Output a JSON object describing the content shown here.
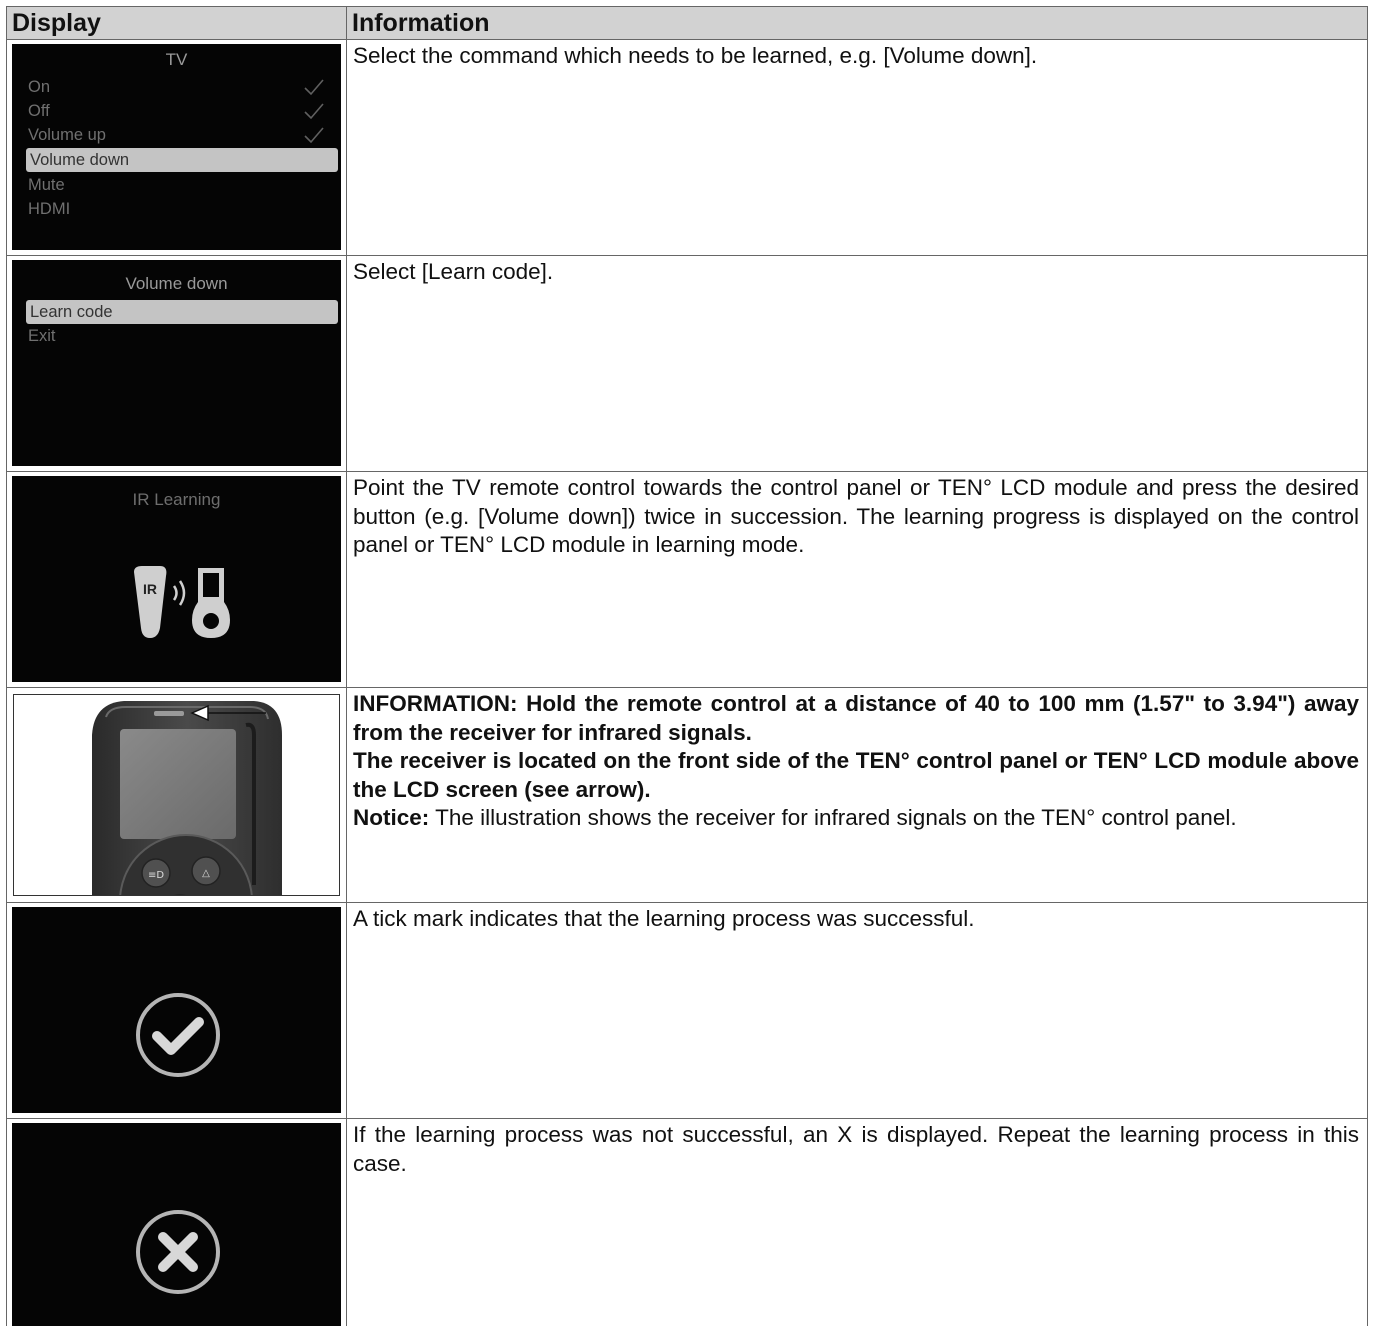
{
  "header": {
    "display": "Display",
    "information": "Information"
  },
  "rows": [
    {
      "screen": {
        "title": "TV",
        "items": [
          {
            "label": "On",
            "checked": true,
            "selected": false
          },
          {
            "label": "Off",
            "checked": true,
            "selected": false
          },
          {
            "label": "Volume up",
            "checked": true,
            "selected": false
          },
          {
            "label": "Volume down",
            "checked": false,
            "selected": true
          },
          {
            "label": "Mute",
            "checked": false,
            "selected": false
          },
          {
            "label": "HDMI",
            "checked": false,
            "selected": false
          }
        ]
      },
      "text": "Select the command which needs to be learned, e.g. [Volume down]."
    },
    {
      "screen": {
        "title": "Volume down",
        "items": [
          {
            "label": "Learn code",
            "selected": true
          },
          {
            "label": "Exit",
            "selected": false
          }
        ]
      },
      "text": "Select [Learn code]."
    },
    {
      "screen": {
        "title": "IR Learning",
        "icon": "ir-learning-icon",
        "icon_label": "IR"
      },
      "text": "Point the TV remote control towards the control panel or TEN° LCD module and press the desired button (e.g. [Volume down]) twice in succession. The learning progress is displayed on the control panel or TEN° LCD module in learning mode."
    },
    {
      "image": "control-panel-receiver-illustration",
      "info_bold_1": "INFORMATION: Hold the remote control at a distance of 40 to 100 mm (1.57\" to 3.94\") away from the receiver for infrared signals.",
      "info_bold_2": "The receiver is located on the front side of the TEN° control panel or TEN° LCD module above the LCD screen (see arrow).",
      "notice_label": "Notice:",
      "notice_text": " The illustration shows the receiver for infrared signals on the TEN° control panel."
    },
    {
      "screen": {
        "icon": "check-circle-icon"
      },
      "text": "A tick mark indicates that the learning process was successful."
    },
    {
      "screen": {
        "icon": "x-circle-icon"
      },
      "text": "If the learning process was not successful, an X is displayed. Repeat the learning process in this case."
    }
  ],
  "colors": {
    "header_bg": "#d2d2d2",
    "screen_bg": "#050505",
    "border": "#666666"
  }
}
